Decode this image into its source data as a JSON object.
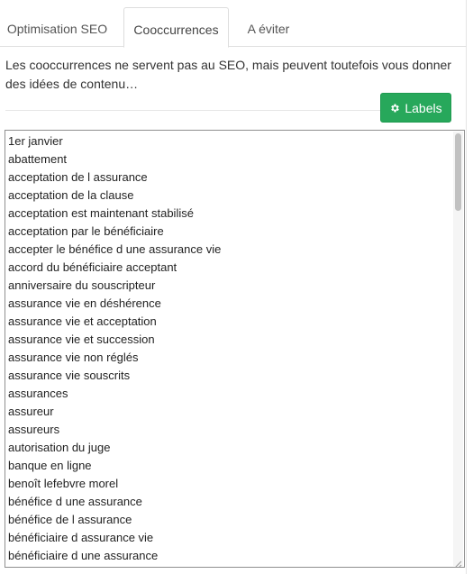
{
  "tabs": [
    {
      "label": "Optimisation SEO"
    },
    {
      "label": "Cooccurrences"
    },
    {
      "label": "A éviter"
    }
  ],
  "intro_text": "Les cooccurrences ne servent pas au SEO, mais peuvent toutefois vous donner des idées de contenu…",
  "labels_button": {
    "label": "Labels",
    "icon": "gear-icon",
    "color": "#27a85b"
  },
  "cooccurrences": [
    "1er janvier",
    "abattement",
    "acceptation de l assurance",
    "acceptation de la clause",
    "acceptation est maintenant stabilisé",
    "acceptation par le bénéficiaire",
    "accepter le bénéfice d une assurance vie",
    "accord du bénéficiaire acceptant",
    "anniversaire du souscripteur",
    "assurance vie en déshérence",
    "assurance vie et acceptation",
    "assurance vie et succession",
    "assurance vie non réglés",
    "assurance vie souscrits",
    "assurances",
    "assureur",
    "assureurs",
    "autorisation du juge",
    "banque en ligne",
    "benoît lefebvre morel",
    "bénéfice d une assurance",
    "bénéfice de l assurance",
    "bénéficiaire d assurance vie",
    "bénéficiaire d une assurance"
  ]
}
